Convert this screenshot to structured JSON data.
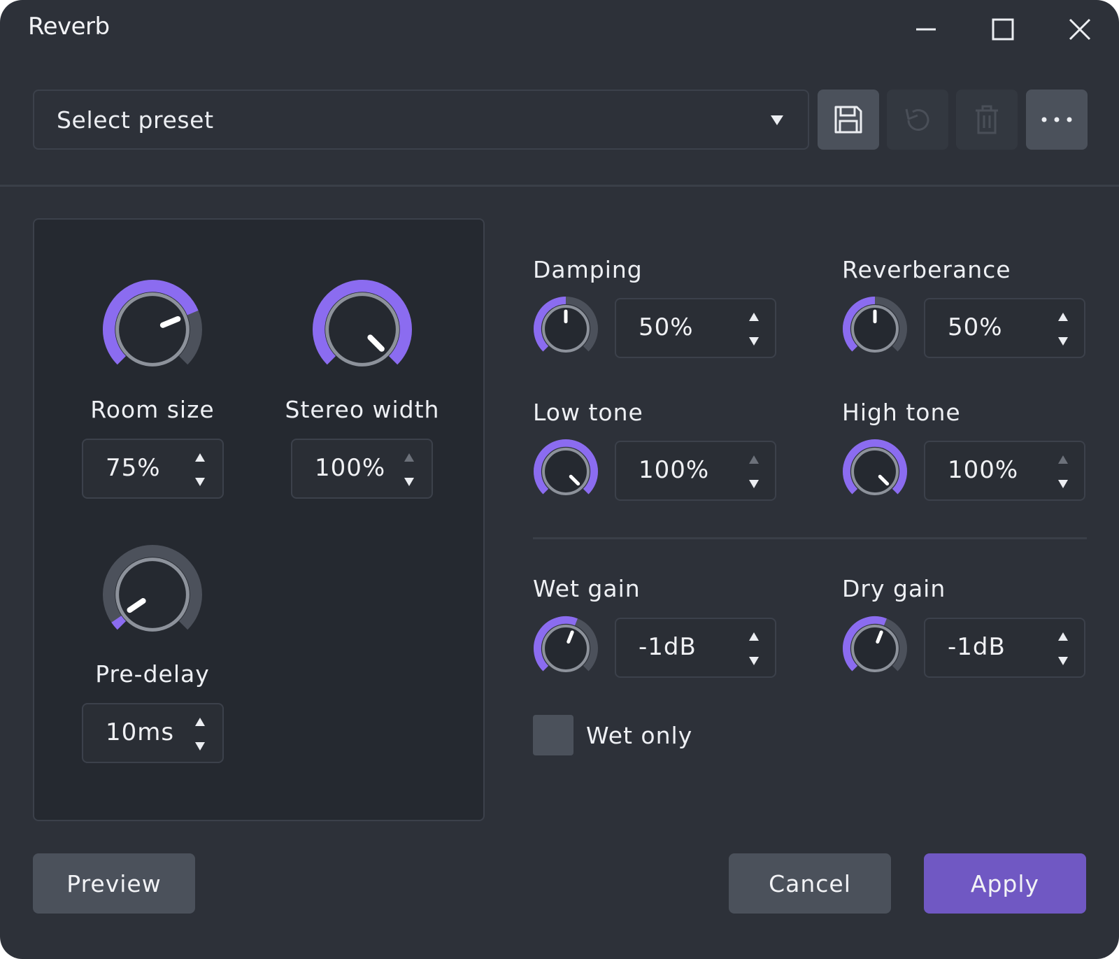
{
  "window": {
    "title": "Reverb"
  },
  "colors": {
    "accent": "#8b6cf0",
    "track": "#4c515b",
    "knob_ring": "#8d929b",
    "window_bg": "#2d3139",
    "panel_bg": "#252930",
    "button_bg": "#4b515b",
    "primary_button_bg": "#7058c3"
  },
  "preset": {
    "placeholder": "Select preset"
  },
  "toolbar": {
    "save": {
      "icon": "save-icon",
      "enabled": true
    },
    "reload": {
      "icon": "reload-icon",
      "enabled": false
    },
    "delete": {
      "icon": "trash-icon",
      "enabled": false
    },
    "more": {
      "icon": "more-icon",
      "enabled": true
    }
  },
  "controls": {
    "room_size": {
      "label": "Room size",
      "value": "75%",
      "fraction": 0.75
    },
    "stereo_width": {
      "label": "Stereo width",
      "value": "100%",
      "fraction": 1.0
    },
    "pre_delay": {
      "label": "Pre-delay",
      "value": "10ms",
      "fraction": 0.04
    },
    "damping": {
      "label": "Damping",
      "value": "50%",
      "fraction": 0.5
    },
    "reverberance": {
      "label": "Reverberance",
      "value": "50%",
      "fraction": 0.5
    },
    "low_tone": {
      "label": "Low tone",
      "value": "100%",
      "fraction": 1.0
    },
    "high_tone": {
      "label": "High tone",
      "value": "100%",
      "fraction": 1.0
    },
    "wet_gain": {
      "label": "Wet gain",
      "value": "-1dB",
      "fraction": 0.58
    },
    "dry_gain": {
      "label": "Dry gain",
      "value": "-1dB",
      "fraction": 0.58
    }
  },
  "wet_only": {
    "label": "Wet only",
    "checked": false
  },
  "buttons": {
    "preview": "Preview",
    "cancel": "Cancel",
    "apply": "Apply"
  }
}
